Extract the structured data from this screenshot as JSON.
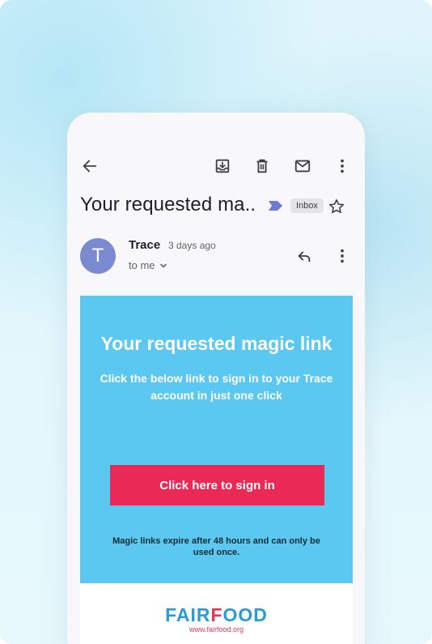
{
  "email": {
    "subject": "Your requested ma..",
    "label_badge": "Inbox",
    "sender_name": "Trace",
    "sender_initial": "T",
    "time": "3 days ago",
    "recipient": "to me"
  },
  "message": {
    "heading": "Your requested magic link",
    "subheading": "Click the below link to sign in to your Trace account in just one click",
    "button_label": "Click here to sign in",
    "note": "Magic links expire after 48 hours and can only be used once."
  },
  "footer": {
    "logo_part1": "FAIR",
    "logo_part2": "F",
    "logo_part3": "OOD",
    "url": "www.fairfood.org"
  },
  "icons": {
    "back": "arrow-left-icon",
    "archive": "archive-icon",
    "delete": "trash-icon",
    "unread": "mail-icon",
    "more": "more-vert-icon",
    "star": "star-outline-icon",
    "reply": "reply-icon",
    "label": "label-chevron-icon"
  },
  "colors": {
    "avatar": "#7a8ad1",
    "email_bg": "#5ac8f0",
    "cta": "#ea2a55",
    "logo_blue": "#2a9ad8",
    "logo_red": "#e33752",
    "label": "#6f7bd0"
  }
}
